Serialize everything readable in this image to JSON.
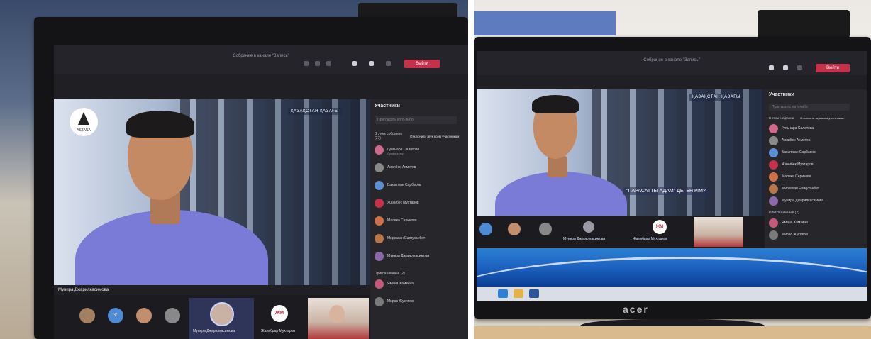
{
  "brand": {
    "monitor": "acer"
  },
  "left_screen": {
    "window_title": "Собрание в канале \"Запись\"",
    "leave_button": "Выйти",
    "video": {
      "banner": "ҚАЗАҚСТАН ҚАЗАҒЫ",
      "logo": "ASTANA"
    },
    "speaker_name": "Мунира Джарилкасимова",
    "panel": {
      "title": "Участники",
      "search_placeholder": "Пригласить кого-либо",
      "group_label": "В этом собрании (27)",
      "mute_all": "Отключить звук всем участникам",
      "participants": [
        {
          "name": "Гульнара Салатова",
          "sub": "Организатор",
          "color": "#d06a8a"
        },
        {
          "name": "Акжибек Ахметов",
          "sub": "",
          "color": "#8a8a8a"
        },
        {
          "name": "Бахытжан Сарбасов",
          "sub": "",
          "color": "#5c8fd6"
        },
        {
          "name": "Жанибек Мухтаров",
          "sub": "",
          "color": "#c4314b"
        },
        {
          "name": "Малика Серикова",
          "sub": "",
          "color": "#d0704b"
        },
        {
          "name": "Мирзахан Ешмуханбет",
          "sub": "",
          "color": "#b8764a"
        },
        {
          "name": "Мунира Джарилкасимова",
          "sub": "",
          "color": "#8c6aa8"
        }
      ],
      "invited_label": "Приглашенные (2)",
      "invited": [
        {
          "name": "Ямина Хамзина",
          "color": "#c45a7a"
        },
        {
          "name": "Мирас Жусипов",
          "color": "#7a7a7a"
        }
      ]
    },
    "strip": {
      "tiles": [
        {
          "initials": "",
          "color": "#a48062"
        },
        {
          "initials": "GC",
          "color": "#4d8bd4"
        },
        {
          "initials": "",
          "color": "#c28f6e"
        },
        {
          "initials": "",
          "color": "#888888"
        }
      ],
      "selected_label": "Мунира Джарилкасимова",
      "second_label": "Жалибдар Мухтаров",
      "second_initials": "ЖМ"
    }
  },
  "right_screen": {
    "window_title": "Собрание в канале \"Запись\"",
    "leave_button": "Выйти",
    "video": {
      "banner": "ҚАЗАҚСТАН ҚАЗАҒЫ",
      "caption": "\"ПАРАСАТТЫ АДАМ\" ДЕГЕН КІМ?"
    },
    "panel": {
      "title": "Участники",
      "search_placeholder": "Пригласить кого-либо",
      "group_label": "В этом собрании",
      "mute_all": "Отключить звук всем участникам",
      "participants": [
        {
          "name": "Гульнара Салатова",
          "color": "#d06a8a"
        },
        {
          "name": "Акжибек Ахметов",
          "color": "#8a8a8a"
        },
        {
          "name": "Бахытжан Сарбасов",
          "color": "#5c8fd6"
        },
        {
          "name": "Жанибек Мухтаров",
          "color": "#c4314b"
        },
        {
          "name": "Малика Серикова",
          "color": "#d0704b"
        },
        {
          "name": "Мирзахан Ешмуханбет",
          "color": "#b8764a"
        },
        {
          "name": "Мунира Джарилкасимова",
          "color": "#8c6aa8"
        }
      ],
      "invited_label": "Приглашенные (2)",
      "invited": [
        {
          "name": "Ямина Хамзина",
          "color": "#c45a7a"
        },
        {
          "name": "Мирас Жусипов",
          "color": "#7a7a7a"
        }
      ]
    },
    "strip": {
      "first_label": "Мунира Джарилкасимова",
      "second_label": "Жалибдар Мухтаров",
      "second_initials": "ЖМ"
    },
    "taskbar_icons": [
      {
        "name": "ie-icon",
        "color": "#2f7fd6"
      },
      {
        "name": "explorer-icon",
        "color": "#e2b447"
      },
      {
        "name": "word-icon",
        "color": "#2b579a"
      }
    ]
  }
}
